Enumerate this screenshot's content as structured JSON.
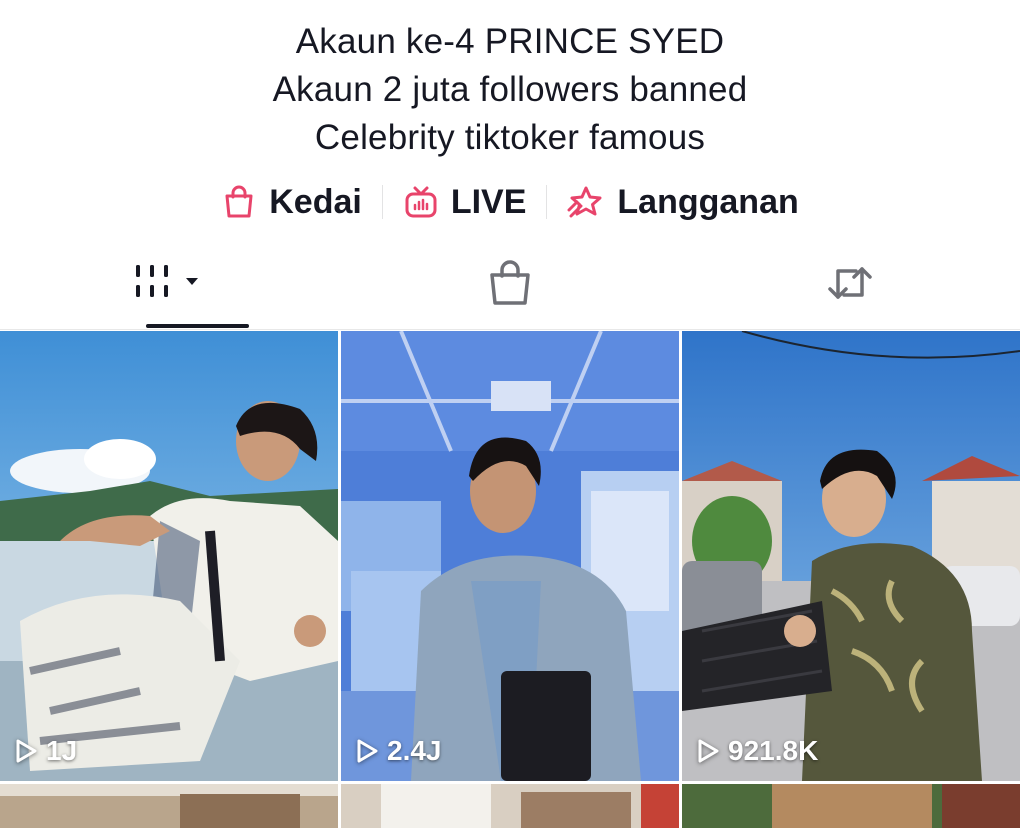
{
  "bio": {
    "lines": [
      "Akaun ke-4 PRINCE SYED",
      "Akaun 2 juta followers banned",
      "Celebrity tiktoker famous"
    ]
  },
  "links": [
    {
      "label": "Kedai",
      "icon": "shopping-bag-icon"
    },
    {
      "label": "LIVE",
      "icon": "tv-live-icon"
    },
    {
      "label": "Langganan",
      "icon": "star-subscription-icon"
    }
  ],
  "tabs": [
    {
      "name": "videos",
      "icon": "grid-dropdown-icon",
      "active": true
    },
    {
      "name": "shop",
      "icon": "shopping-bag-icon",
      "active": false
    },
    {
      "name": "reposts",
      "icon": "repost-icon",
      "active": false
    }
  ],
  "colors": {
    "accent": "#e8446b",
    "text": "#161823",
    "icon_gray": "#6f7076"
  },
  "videos": [
    {
      "views": "1J"
    },
    {
      "views": "2.4J"
    },
    {
      "views": "921.8K"
    }
  ]
}
